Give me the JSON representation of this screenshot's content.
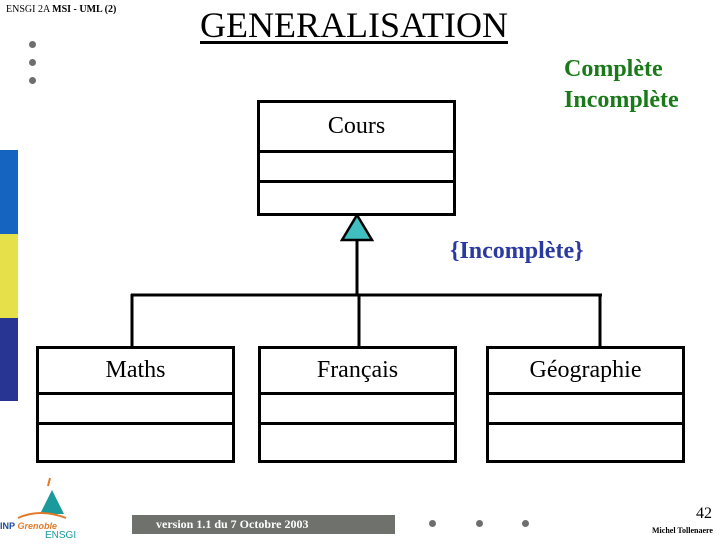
{
  "header": {
    "course_prefix": "ENSGI 2A ",
    "course_bold": "MSI - UML (2)"
  },
  "slide": {
    "title": "GENERALISATION",
    "notes_green": [
      "Complète",
      "Incomplète"
    ],
    "constraint": "{Incomplète}"
  },
  "diagram": {
    "parent_class": {
      "name": "Cours"
    },
    "child_classes": [
      {
        "name": "Maths"
      },
      {
        "name": "Français"
      },
      {
        "name": "Géographie"
      }
    ],
    "relationship": "generalization"
  },
  "colors": {
    "note_green": "#1a7a1a",
    "constraint_blue": "#2a3aa0",
    "triangle_fill": "#3fbfbf",
    "sidebar": [
      "#1565c0",
      "#e6e04a",
      "#283593"
    ],
    "footer_bar": "#6f716d"
  },
  "footer": {
    "version": "version 1.1 du 7 Octobre 2003",
    "page_number": "42",
    "author": "Michel Tollenaere",
    "logo": {
      "institution": "INP Grenoble",
      "school": "ENSGI"
    }
  }
}
